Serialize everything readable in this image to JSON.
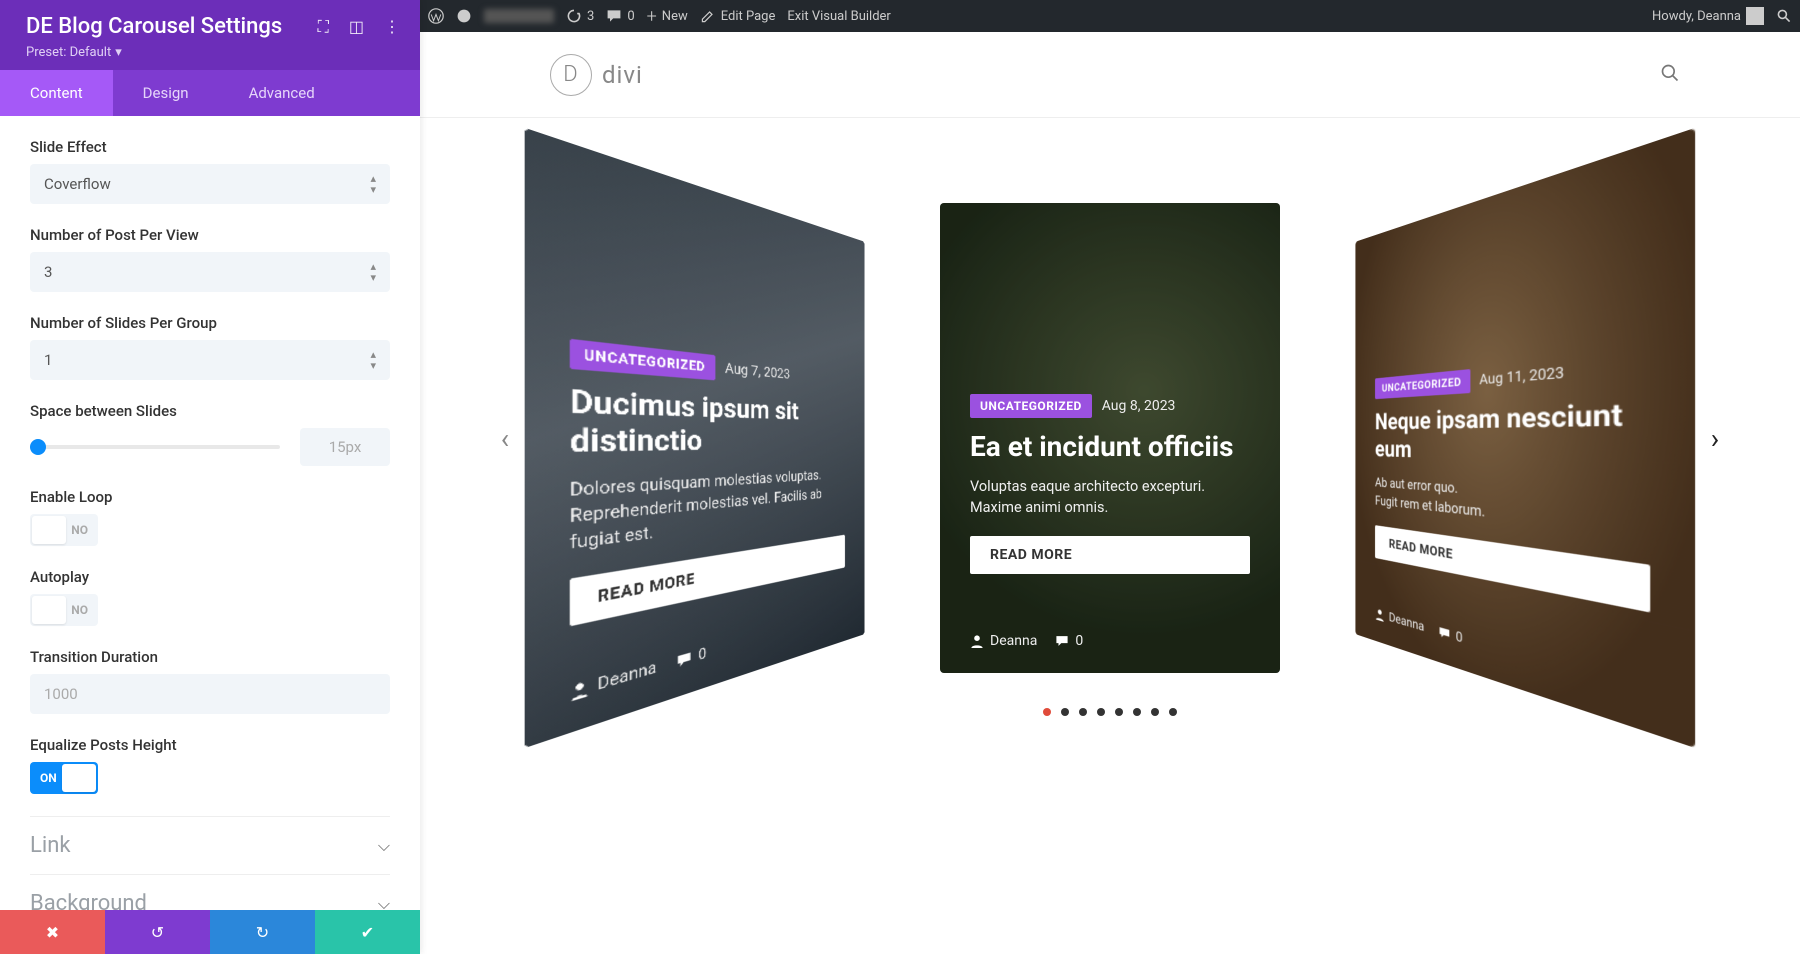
{
  "wp_bar": {
    "updates": "3",
    "comments": "0",
    "new": "New",
    "edit_page": "Edit Page",
    "exit_builder": "Exit Visual Builder",
    "greeting": "Howdy, Deanna"
  },
  "sidebar": {
    "title": "DE Blog Carousel Settings",
    "preset_label": "Preset: Default",
    "tabs": {
      "content": "Content",
      "design": "Design",
      "advanced": "Advanced"
    },
    "fields": {
      "slide_effect": {
        "label": "Slide Effect",
        "value": "Coverflow"
      },
      "posts_per_view": {
        "label": "Number of Post Per View",
        "value": "3"
      },
      "slides_per_group": {
        "label": "Number of Slides Per Group",
        "value": "1"
      },
      "space_between": {
        "label": "Space between Slides",
        "value": "15px"
      },
      "enable_loop": {
        "label": "Enable Loop",
        "value": "NO"
      },
      "autoplay": {
        "label": "Autoplay",
        "value": "NO"
      },
      "transition_duration": {
        "label": "Transition Duration",
        "value": "1000"
      },
      "equalize_height": {
        "label": "Equalize Posts Height",
        "value": "ON"
      }
    },
    "accordions": {
      "link": "Link",
      "background": "Background"
    }
  },
  "site": {
    "logo_text": "divi"
  },
  "carousel": {
    "readmore": "READ MORE",
    "cards": [
      {
        "tag": "UNCATEGORIZED",
        "date": "Aug 7, 2023",
        "title": "Ducimus ipsum sit distinctio",
        "excerpt": "Dolores quisquam molestias voluptas. Reprehenderit molestias vel. Facilis ab fugiat est.",
        "author": "Deanna",
        "comments": "0"
      },
      {
        "tag": "UNCATEGORIZED",
        "date": "Aug 8, 2023",
        "title": "Ea et incidunt officiis",
        "excerpt": "Voluptas eaque architecto excepturi. Maxime animi omnis.",
        "author": "Deanna",
        "comments": "0"
      },
      {
        "tag": "UNCATEGORIZED",
        "date": "Aug 11, 2023",
        "title": "Neque ipsam nesciunt eum",
        "excerpt": "Ab aut error quo.\nFugit rem et laborum.",
        "author": "Deanna",
        "comments": "0"
      }
    ],
    "total_dots": 8
  }
}
